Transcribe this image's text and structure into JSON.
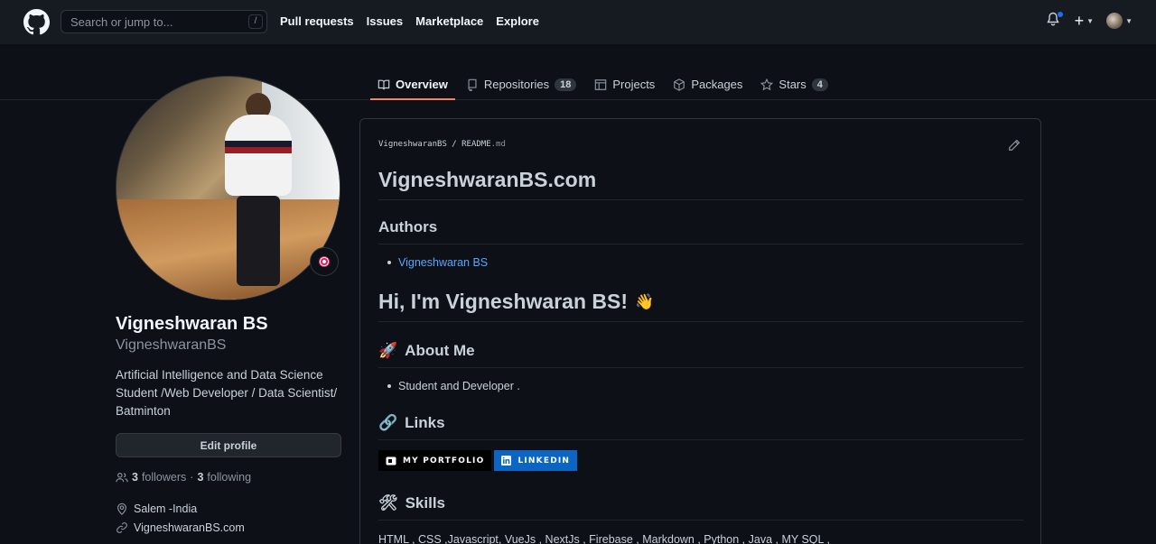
{
  "header": {
    "search_placeholder": "Search or jump to...",
    "slash": "/",
    "nav": [
      "Pull requests",
      "Issues",
      "Marketplace",
      "Explore"
    ],
    "plus": "+"
  },
  "tabs": [
    {
      "label": "Overview",
      "active": true
    },
    {
      "label": "Repositories",
      "count": "18"
    },
    {
      "label": "Projects"
    },
    {
      "label": "Packages"
    },
    {
      "label": "Stars",
      "count": "4"
    }
  ],
  "profile": {
    "name": "Vigneshwaran BS",
    "login": "VigneshwaranBS",
    "bio": "Artificial Intelligence and Data Science Student /Web Developer / Data Scientist/ Batminton",
    "edit_label": "Edit profile",
    "followers_count": "3",
    "followers_label": "followers",
    "sep": "·",
    "following_count": "3",
    "following_label": "following",
    "location": "Salem -India",
    "website": "VigneshwaranBS.com"
  },
  "readme": {
    "crumb_user": "VigneshwaranBS",
    "crumb_sep": "/",
    "crumb_file": "README",
    "crumb_ext": ".md",
    "title": "VigneshwaranBS.com",
    "authors_heading": "Authors",
    "author_link": "Vigneshwaran BS",
    "hi_heading": "Hi, I'm Vigneshwaran BS!",
    "hi_emoji": "👋",
    "about_emoji": "🚀",
    "about_heading": "About Me",
    "about_item": "Student and Developer .",
    "links_emoji": "🔗",
    "links_heading": "Links",
    "badge_portfolio": "MY PORTFOLIO",
    "badge_linkedin": "LINKEDIN",
    "skills_emoji": "🛠",
    "skills_heading": "Skills",
    "skills_text": "HTML , CSS ,Javascript, VueJs , NextJs , Firebase , Markdown , Python , Java , MY SQL ,"
  },
  "colors": {
    "background": "#0d1117",
    "header": "#161b22",
    "link": "#58a6ff",
    "tab_underline": "#f78166",
    "linkedin": "#0a66c2"
  }
}
